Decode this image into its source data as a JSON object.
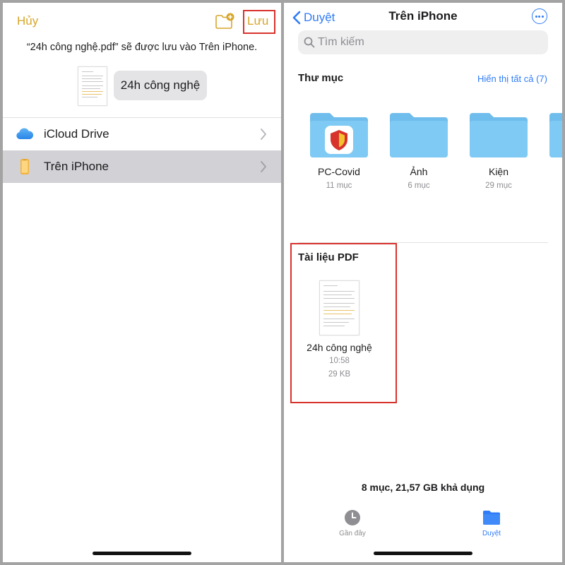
{
  "left": {
    "cancel_label": "Hủy",
    "save_label": "Lưu",
    "message": "“24h công nghệ.pdf” sẽ được lưu vào Trên iPhone.",
    "filename": "24h công nghệ",
    "locations": [
      {
        "label": "iCloud Drive",
        "icon": "icloud-icon",
        "selected": false
      },
      {
        "label": "Trên iPhone",
        "icon": "iphone-icon",
        "selected": true
      }
    ]
  },
  "right": {
    "back_label": "Duyệt",
    "title": "Trên iPhone",
    "search_placeholder": "Tìm kiếm",
    "folders_section_title": "Thư mục",
    "show_all_label": "Hiển thị tất cả (7)",
    "folders": [
      {
        "name": "PC-Covid",
        "count": "11 mục"
      },
      {
        "name": "Ảnh",
        "count": "6 mục"
      },
      {
        "name": "Kiện",
        "count": "29 mục"
      }
    ],
    "pdf_section_title": "Tài liệu PDF",
    "document": {
      "name": "24h công nghệ",
      "time": "10:58",
      "size": "29 KB"
    },
    "storage_text": "8 mục, 21,57 GB khả dụng",
    "tabs": [
      {
        "label": "Gần đây",
        "icon": "clock-icon",
        "active": false
      },
      {
        "label": "Duyệt",
        "icon": "folder-icon",
        "active": true
      }
    ]
  },
  "colors": {
    "accent_yellow": "#d7a62a",
    "accent_blue": "#2f7cf6",
    "highlight_red": "#d8322c",
    "folder_blue": "#7cc6f2",
    "selected_row": "#d1d1d6"
  }
}
